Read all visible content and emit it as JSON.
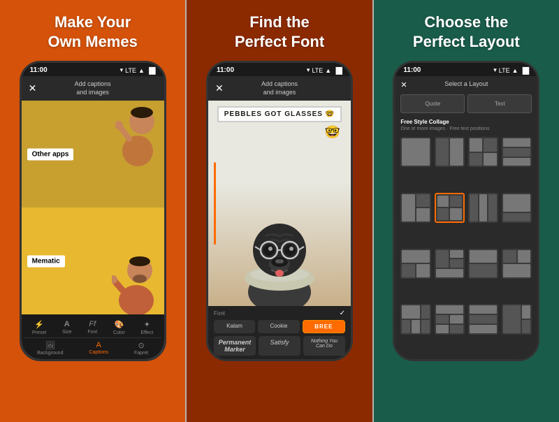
{
  "panels": [
    {
      "id": "panel1",
      "title": "Make Your\nOwn Memes",
      "bg": "panel-orange"
    },
    {
      "id": "panel2",
      "title": "Find the\nPerfect Font",
      "bg": "panel-dark-orange"
    },
    {
      "id": "panel3",
      "title": "Choose the\nPerfect Layout",
      "bg": "panel-teal"
    }
  ],
  "phone1": {
    "status_time": "11:00",
    "status_signal": "▼ LTE ▲ █",
    "header_title": "Add captions\nand images",
    "meme_top_label": "Other apps",
    "meme_bottom_label": "Mematic",
    "toolbar_items": [
      {
        "icon": "⚡",
        "label": "Preset",
        "active": false
      },
      {
        "icon": "A",
        "label": "Size",
        "active": false
      },
      {
        "icon": "Ff",
        "label": "Font",
        "active": false
      },
      {
        "icon": "●",
        "label": "Color",
        "active": false
      },
      {
        "icon": "✦",
        "label": "Effect",
        "active": false
      }
    ],
    "tab_items": [
      {
        "icon": "🖼",
        "label": "Background",
        "active": false
      },
      {
        "icon": "A",
        "label": "Captions",
        "active": true
      },
      {
        "icon": "✱",
        "label": "Fapret",
        "active": false
      }
    ]
  },
  "phone2": {
    "status_time": "11:00",
    "status_signal": "▼ LTE ▲ █",
    "header_title": "Add captions\nand images",
    "meme_text": "PEBBLES GOT GLASSES 🤓",
    "font_label": "Font",
    "fonts": [
      {
        "name": "Kalam",
        "active": false
      },
      {
        "name": "Cookie",
        "active": false
      },
      {
        "name": "BREE",
        "active": true
      }
    ],
    "fonts_row2": [
      {
        "name": "Permanent\nMarker",
        "style": "italic"
      },
      {
        "name": "Satisfy",
        "style": "italic"
      },
      {
        "name": "Nothing You\nCan Do",
        "style": "italic"
      }
    ]
  },
  "phone3": {
    "status_time": "11:00",
    "status_signal": "▼ LTE ▲ █",
    "header_title": "Select a Layout",
    "quote_label": "Quote",
    "text_label": "Text",
    "freestyle_title": "Free Style Collage",
    "freestyle_sub": "One or more images · Free text positions"
  }
}
